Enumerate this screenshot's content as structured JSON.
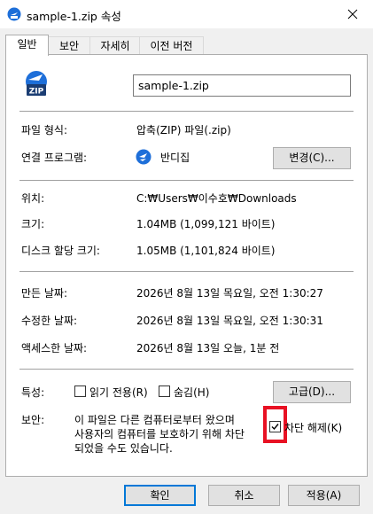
{
  "window": {
    "title": "sample-1.zip 속성",
    "title_icon": "zip-file-icon",
    "close_icon": "close-icon"
  },
  "tabs": [
    {
      "label": "일반",
      "active": true
    },
    {
      "label": "보안",
      "active": false
    },
    {
      "label": "자세히",
      "active": false
    },
    {
      "label": "이전 버전",
      "active": false
    }
  ],
  "general": {
    "file_icon": "zip-file-icon",
    "file_icon_text": "ZIP",
    "file_name": "sample-1.zip",
    "file_type_label": "파일 형식:",
    "file_type_value": "압축(ZIP) 파일(.zip)",
    "opens_with_label": "연결 프로그램:",
    "opens_with_value": "반디집",
    "opens_with_icon": "bandizip-icon",
    "change_button": "변경(C)...",
    "location_label": "위치:",
    "location_value": "C:₩Users₩이수호₩Downloads",
    "size_label": "크기:",
    "size_value": "1.04MB (1,099,121 바이트)",
    "size_on_disk_label": "디스크 할당 크기:",
    "size_on_disk_value": "1.05MB (1,101,824 바이트)",
    "created_label": "만든 날짜:",
    "created_value": "2026년 8월 13일 목요일, 오전 1:30:27",
    "modified_label": "수정한 날짜:",
    "modified_value": "2026년 8월 13일 목요일, 오전 1:30:31",
    "accessed_label": "액세스한 날짜:",
    "accessed_value": "2026년 8월 13일 오늘, 1분 전",
    "attributes_label": "특성:",
    "readonly_label": "읽기 전용(R)",
    "readonly_checked": false,
    "hidden_label": "숨김(H)",
    "hidden_checked": false,
    "advanced_button": "고급(D)...",
    "security_label": "보안:",
    "security_line1": "이 파일은 다른 컴퓨터로부터 왔으며",
    "security_line2": "사용자의 컴퓨터를 보호하기 위해 차단",
    "security_line3": "되었을 수도 있습니다.",
    "unblock_label": "차단 해제(K)",
    "unblock_checked": true
  },
  "footer": {
    "ok_button": "확인",
    "cancel_button": "취소",
    "apply_button": "적용(A)"
  },
  "colors": {
    "highlight": "#e81123",
    "accent": "#0078d7"
  }
}
